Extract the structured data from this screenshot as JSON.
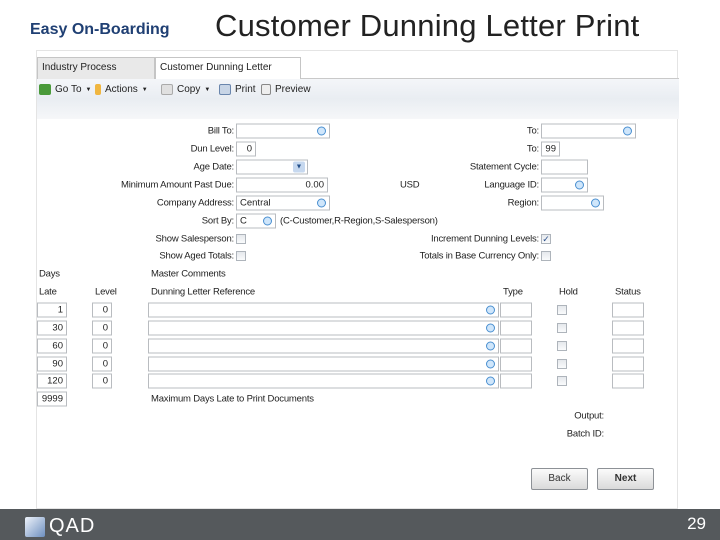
{
  "slide": {
    "subtitle": "Easy On-Boarding",
    "title": "Customer Dunning Letter Print",
    "page_number": "29",
    "logo": "QAD"
  },
  "tabs": [
    {
      "label": "Industry Process Model",
      "active": false
    },
    {
      "label": "Customer Dunning Letter Print",
      "active": true
    }
  ],
  "toolbar": {
    "goto": "Go To",
    "actions": "Actions",
    "copy": "Copy",
    "print": "Print",
    "preview": "Preview"
  },
  "form": {
    "bill_to": {
      "label": "Bill To:",
      "value": ""
    },
    "bill_to_to": {
      "label": "To:",
      "value": ""
    },
    "dun_level": {
      "label": "Dun Level:",
      "value": "0"
    },
    "dun_level_to": {
      "label": "To:",
      "value": "99"
    },
    "age_date": {
      "label": "Age Date:",
      "value": ""
    },
    "statement_cycle": {
      "label": "Statement Cycle:",
      "value": ""
    },
    "min_amount": {
      "label": "Minimum Amount Past Due:",
      "value": "0.00",
      "currency": "USD"
    },
    "language_id": {
      "label": "Language ID:",
      "value": ""
    },
    "company_address": {
      "label": "Company Address:",
      "value": "Central"
    },
    "region": {
      "label": "Region:",
      "value": ""
    },
    "sort_by": {
      "label": "Sort By:",
      "value": "C",
      "hint": "(C-Customer,R-Region,S-Salesperson)"
    },
    "show_salesperson": {
      "label": "Show Salesperson:",
      "checked": false
    },
    "increment_dunning": {
      "label": "Increment Dunning Levels:",
      "checked": true
    },
    "show_aged_totals": {
      "label": "Show Aged Totals:",
      "checked": false
    },
    "totals_base": {
      "label": "Totals in Base Currency Only:",
      "checked": false
    }
  },
  "table": {
    "headers": {
      "days": "Days",
      "late": "Late",
      "level": "Level",
      "master_comments": "Master Comments",
      "reference": "Dunning Letter Reference",
      "type": "Type",
      "hold": "Hold",
      "status": "Status"
    },
    "rows": [
      {
        "late": "1",
        "level": "0",
        "reference": "",
        "type": "",
        "hold": false,
        "status": ""
      },
      {
        "late": "30",
        "level": "0",
        "reference": "",
        "type": "",
        "hold": false,
        "status": ""
      },
      {
        "late": "60",
        "level": "0",
        "reference": "",
        "type": "",
        "hold": false,
        "status": ""
      },
      {
        "late": "90",
        "level": "0",
        "reference": "",
        "type": "",
        "hold": false,
        "status": ""
      },
      {
        "late": "120",
        "level": "0",
        "reference": "",
        "type": "",
        "hold": false,
        "status": ""
      }
    ],
    "max_days": {
      "value": "9999",
      "label": "Maximum Days Late to Print Documents"
    }
  },
  "output": {
    "label": "Output:",
    "batch_label": "Batch ID:"
  },
  "buttons": {
    "back": "Back",
    "next": "Next"
  }
}
